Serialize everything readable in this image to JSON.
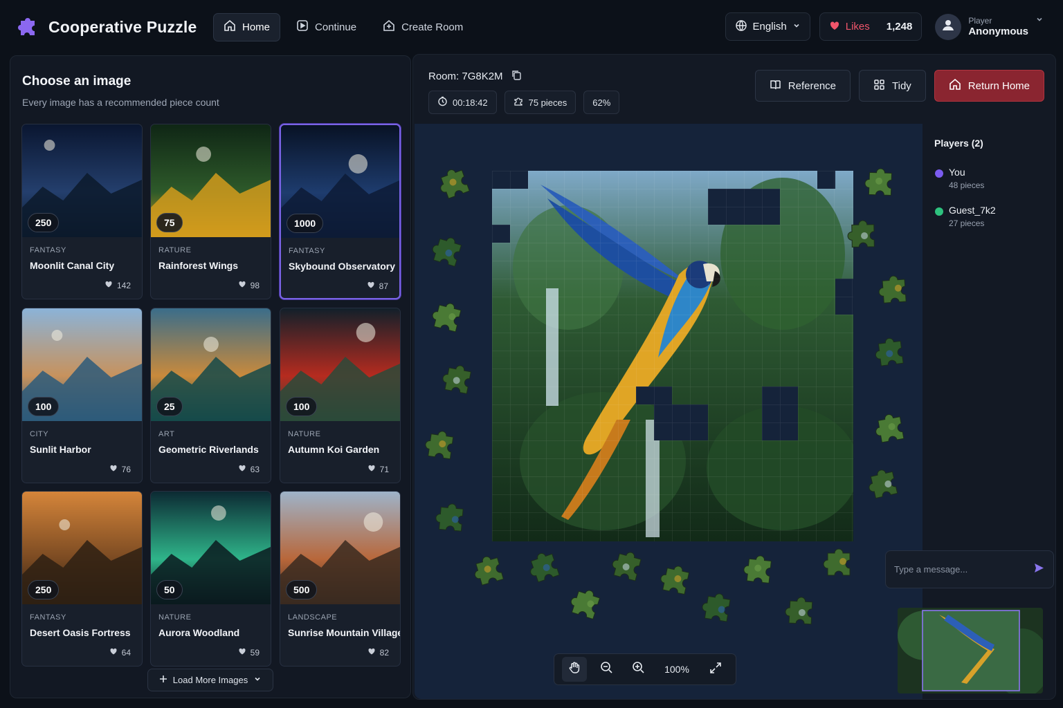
{
  "header": {
    "app_title": "Cooperative Puzzle",
    "nav": [
      {
        "label": "Home",
        "active": true,
        "icon": "home-icon"
      },
      {
        "label": "Continue",
        "icon": "play-square-icon"
      },
      {
        "label": "Create Room",
        "icon": "plus-house-icon"
      }
    ],
    "language": "English",
    "likes_label": "Likes",
    "likes_count": "1,248",
    "player_role": "Player",
    "player_name": "Anonymous"
  },
  "gallery": {
    "title": "Choose an image",
    "subtitle": "Every image has a recommended piece count",
    "cards": [
      {
        "pieces": "250",
        "category": "FANTASY",
        "title": "Moonlit Canal City",
        "likes": "142",
        "selected": false,
        "palette": [
          "#0a1630",
          "#243f6d",
          "#0c1a2c"
        ]
      },
      {
        "pieces": "75",
        "category": "RATURE",
        "title": "Rainforest Wings",
        "likes": "98",
        "selected": false,
        "palette": [
          "#0f2615",
          "#2e5a2a",
          "#d29b1c"
        ]
      },
      {
        "pieces": "1000",
        "category": "FANTASY",
        "title": "Skybound Observatory",
        "likes": "87",
        "selected": true,
        "palette": [
          "#081225",
          "#1e3c6e",
          "#0d1b36"
        ]
      },
      {
        "pieces": "100",
        "category": "CITY",
        "title": "Sunlit Harbor",
        "likes": "76",
        "selected": false,
        "palette": [
          "#8bb3d8",
          "#c7925d",
          "#2d5a7a"
        ]
      },
      {
        "pieces": "25",
        "category": "ART",
        "title": "Geometric Riverlands",
        "likes": "63",
        "selected": false,
        "palette": [
          "#3a6d8a",
          "#c98a3c",
          "#154a4a"
        ]
      },
      {
        "pieces": "100",
        "category": "NATURE",
        "title": "Autumn Koi Garden",
        "likes": "71",
        "selected": false,
        "palette": [
          "#12202a",
          "#b62b1f",
          "#2a4a3a"
        ]
      },
      {
        "pieces": "250",
        "category": "FANTASY",
        "title": "Desert Oasis Fortress",
        "likes": "64",
        "selected": false,
        "palette": [
          "#d5853a",
          "#7a4a22",
          "#2e2013"
        ]
      },
      {
        "pieces": "50",
        "category": "NATURE",
        "title": "Aurora Woodland",
        "likes": "59",
        "selected": false,
        "palette": [
          "#0c2a33",
          "#2fb58a",
          "#0a1a1e"
        ]
      },
      {
        "pieces": "500",
        "category": "LANDSCAPE",
        "title": "Sunrise Mountain Village",
        "likes": "82",
        "selected": false,
        "palette": [
          "#9eb3c9",
          "#b8673a",
          "#3a2a20"
        ]
      }
    ],
    "load_more": "Load More Images"
  },
  "room": {
    "label": "Room: 7G8K2M",
    "timer": "00:18:42",
    "pieces": "75 pieces",
    "progress_label": "62%",
    "progress": 0.62,
    "actions": {
      "reference": "Reference",
      "tidy": "Tidy",
      "return_home": "Return Home"
    }
  },
  "players": {
    "title": "Players (2)",
    "list": [
      {
        "name": "You",
        "pieces": "48 pieces",
        "color": "#7b5cf0"
      },
      {
        "name": "Guest_7k2",
        "pieces": "27 pieces",
        "color": "#2ec27e"
      }
    ]
  },
  "chat": {
    "placeholder": "Type a message..."
  },
  "zoom": {
    "level": "100%"
  },
  "colors": {
    "accent": "#7a63e6",
    "danger": "#8a2530",
    "likes": "#f0556b"
  }
}
